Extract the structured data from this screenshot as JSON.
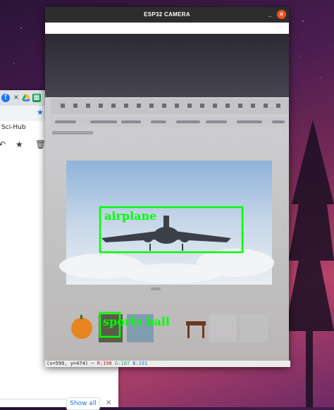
{
  "desktop": {
    "wallpaper_colors": [
      "#2a1438",
      "#b8436a"
    ]
  },
  "browser": {
    "tab_close_glyph": "×",
    "bookmark_label": "Sci-Hub",
    "show_all_label": "Show all",
    "close_glyph": "×"
  },
  "camera_window": {
    "title": "ESP32 CAMERA",
    "minimize_glyph": "_",
    "close_glyph": "×",
    "detections": [
      {
        "label": "airplane"
      },
      {
        "label": "sports ball"
      }
    ],
    "status": {
      "coords": "(x=599, y=474) ~",
      "r": "R:198",
      "g": "G:187",
      "b": "B:191"
    },
    "accent_color": "#00ff00"
  }
}
